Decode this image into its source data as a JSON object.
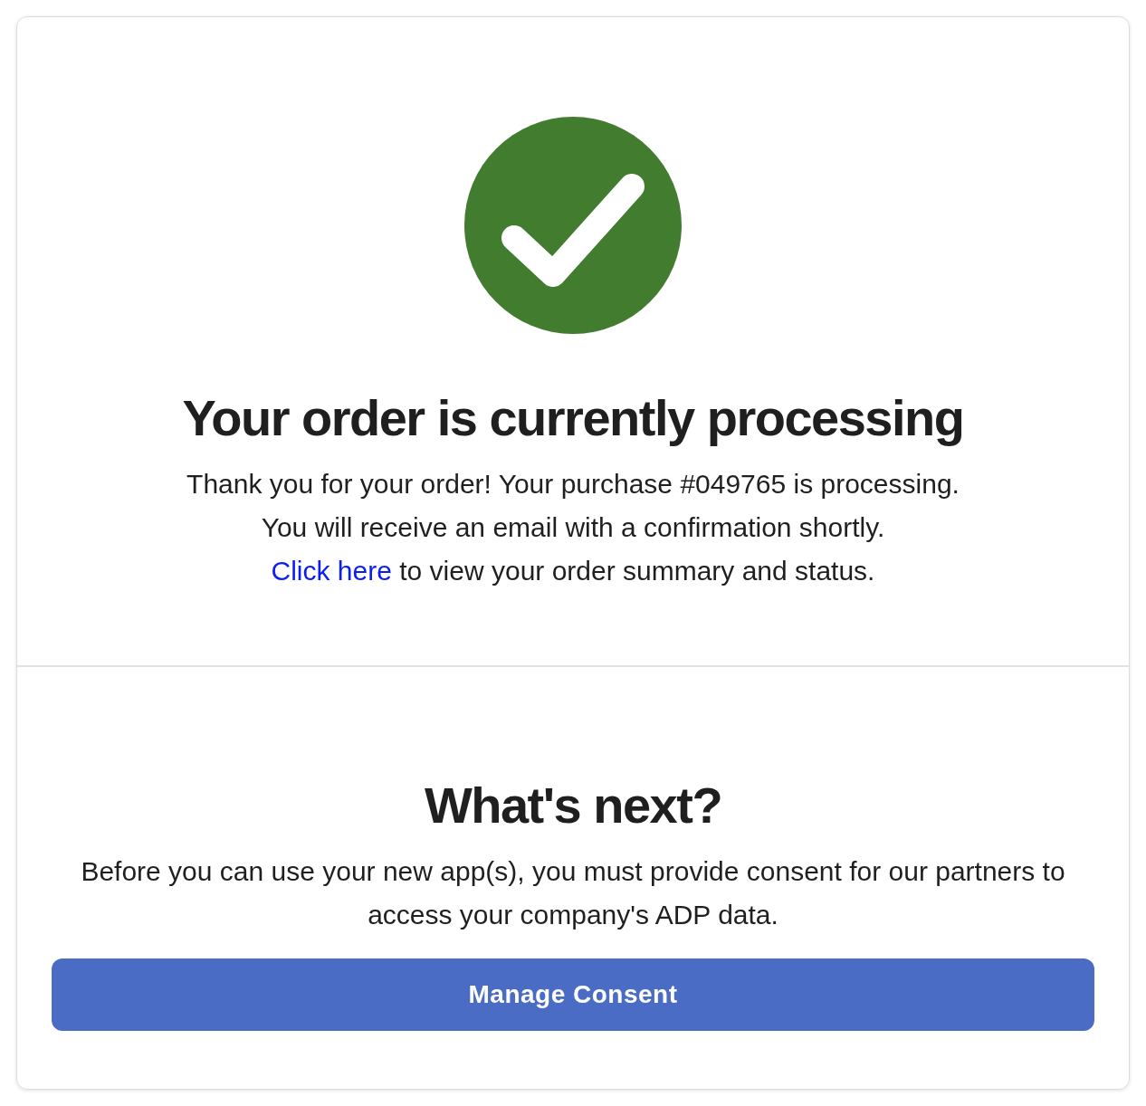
{
  "confirmation": {
    "title": "Your order is currently processing",
    "lines": [
      "Thank you for your order! Your purchase #049765 is processing.",
      "You will receive an email with a confirmation shortly."
    ],
    "link": {
      "text": "Click here",
      "after": " to view your order summary and status."
    }
  },
  "next": {
    "title": "What's next?",
    "text": "Before you can use your new app(s), you must provide consent for our partners to access your company's ADP data.",
    "button": "Manage Consent"
  }
}
